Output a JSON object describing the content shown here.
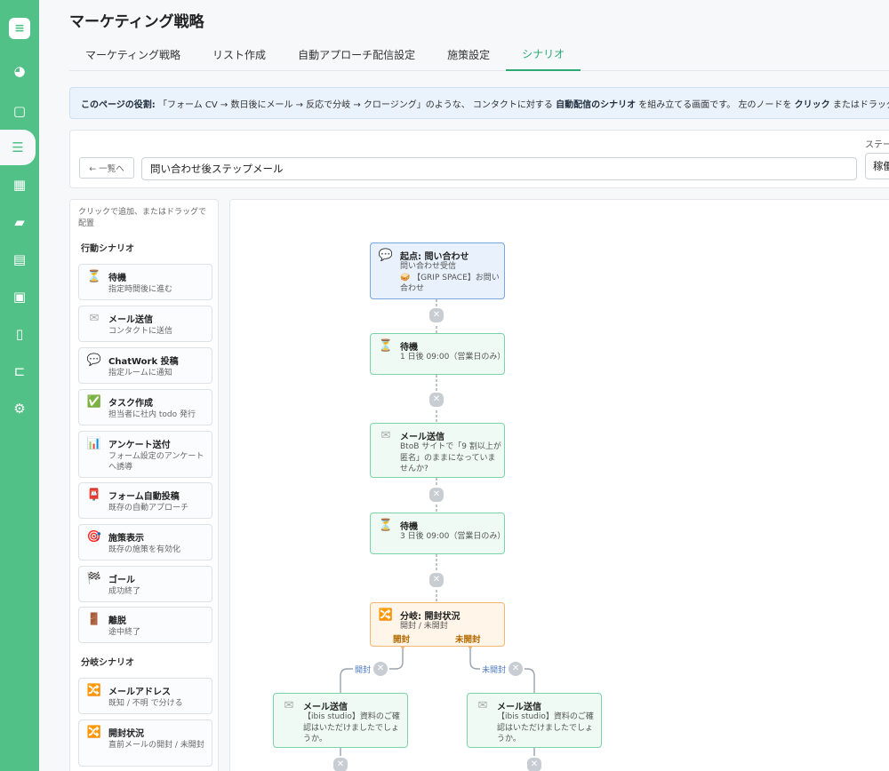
{
  "page": {
    "title": "マーケティング戦略"
  },
  "tabs": [
    {
      "label": "マーケティング戦略"
    },
    {
      "label": "リスト作成"
    },
    {
      "label": "自動アプローチ配信設定"
    },
    {
      "label": "施策設定"
    },
    {
      "label": "シナリオ"
    }
  ],
  "banner": {
    "lead": "このページの役割:",
    "text1": "「フォーム CV → 数日後にメール → 反応で分岐 → クロージング」のような、 コンタクトに対する",
    "bold1": "自動配信のシナリオ",
    "text2": "を組み立てる画面です。 左のノードを",
    "bold2": "クリック",
    "text3": "またはドラッグでキャンパ"
  },
  "toolbar": {
    "back_label": "← 一覧へ",
    "scenario_name": "問い合わせ後ステップメール",
    "status_label": "ステータス",
    "status_value": "稼働中"
  },
  "palette": {
    "hint": "クリックで追加、またはドラッグで配置",
    "section_action": "行動シナリオ",
    "section_branch": "分岐シナリオ",
    "items": [
      {
        "icon": "⏳",
        "title": "待機",
        "desc": "指定時間後に進む"
      },
      {
        "icon": "✉",
        "title": "メール送信",
        "desc": "コンタクトに送信"
      },
      {
        "icon": "💬",
        "title": "ChatWork 投稿",
        "desc": "指定ルームに通知"
      },
      {
        "icon": "✅",
        "title": "タスク作成",
        "desc": "担当者に社内 todo 発行"
      },
      {
        "icon": "📊",
        "title": "アンケート送付",
        "desc": "フォーム設定のアンケートへ誘導"
      },
      {
        "icon": "📮",
        "title": "フォーム自動投稿",
        "desc": "既存の自動アプローチ"
      },
      {
        "icon": "🎯",
        "title": "施策表示",
        "desc": "既存の施策を有効化"
      },
      {
        "icon": "🏁",
        "title": "ゴール",
        "desc": "成功終了"
      },
      {
        "icon": "🚪",
        "title": "離脱",
        "desc": "途中終了"
      }
    ],
    "branch_items": [
      {
        "icon": "🔀",
        "title": "メールアドレス",
        "desc": "既知 / 不明 で分ける"
      },
      {
        "icon": "🔀",
        "title": "開封状況",
        "desc": "直前メールの開封 / 未開封"
      }
    ]
  },
  "flow": {
    "start": {
      "icon": "💬",
      "title": "起点: 問い合わせ",
      "line1": "問い合わせ受信",
      "line2": "🥪 【GRIP SPACE】お問い合わせ"
    },
    "wait1": {
      "icon": "⏳",
      "title": "待機",
      "body": "1 日後 09:00（営業日のみ）"
    },
    "mail1": {
      "icon": "✉",
      "title": "メール送信",
      "body": "BtoB サイトで「9 割以上が匿名」のままになっていませんか?"
    },
    "wait2": {
      "icon": "⏳",
      "title": "待機",
      "body": "3 日後 09:00（営業日のみ）"
    },
    "branch": {
      "icon": "🔀",
      "title": "分岐: 開封状況",
      "body": "開封 / 未開封",
      "yes": "開封",
      "no": "未開封"
    },
    "edge_yes": "開封",
    "edge_no": "未開封",
    "mail_yes": {
      "icon": "✉",
      "title": "メール送信",
      "body": "【ibis studio】資料のご確認はいただけましたでしょうか。"
    },
    "mail_no": {
      "icon": "✉",
      "title": "メール送信",
      "body": "【ibis studio】資料のご確認はいただけましたでしょうか。"
    },
    "delete_glyph": "✕"
  },
  "colors": {
    "sidebar": "#52c187",
    "accent": "#2eab73",
    "start": "#7aa7e0",
    "action": "#7dd3a8",
    "branch": "#f2b572"
  }
}
